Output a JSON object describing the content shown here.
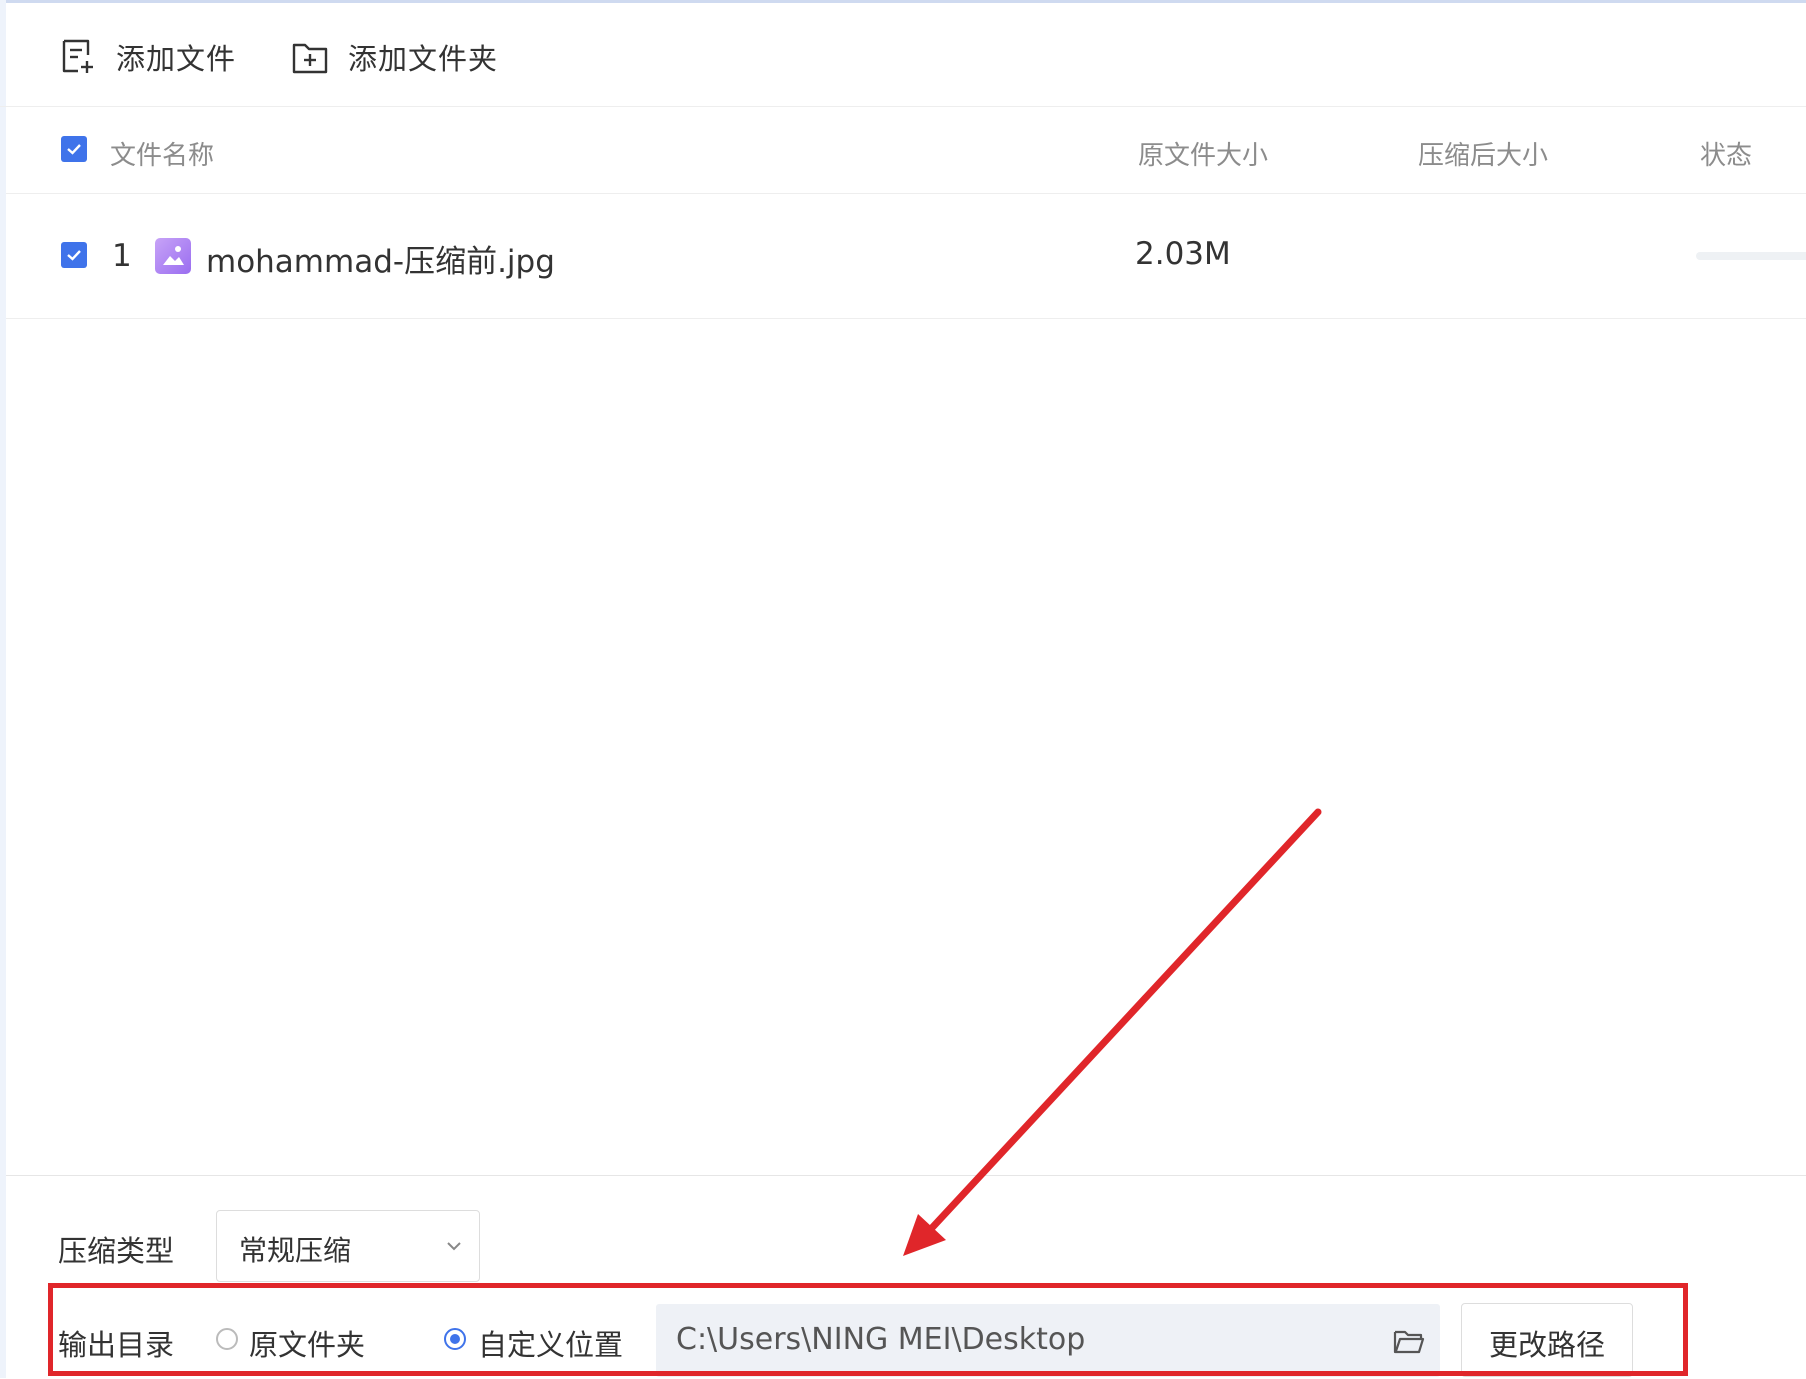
{
  "toolbar": {
    "add_file_label": "添加文件",
    "add_folder_label": "添加文件夹"
  },
  "table": {
    "headers": {
      "name": "文件名称",
      "original_size": "原文件大小",
      "compressed_size": "压缩后大小",
      "status": "状态"
    },
    "rows": [
      {
        "index": "1",
        "name": "mohammad-压缩前.jpg",
        "original_size": "2.03M",
        "compressed_size": "",
        "checked": true
      }
    ]
  },
  "settings": {
    "compress_type_label": "压缩类型",
    "compress_type_value": "常规压缩",
    "output_dir_label": "输出目录",
    "option_original_folder": "原文件夹",
    "option_custom_location": "自定义位置",
    "selected_option": "custom",
    "output_path": "C:\\Users\\NING MEI\\Desktop",
    "change_path_label": "更改路径"
  },
  "colors": {
    "accent": "#3f73ea",
    "annotation_red": "#e0262a"
  },
  "icons": {
    "add_file": "add-file-icon",
    "add_folder": "add-folder-icon",
    "file_type": "image-file-icon",
    "folder": "folder-open-icon",
    "dropdown": "chevron-down-icon"
  }
}
